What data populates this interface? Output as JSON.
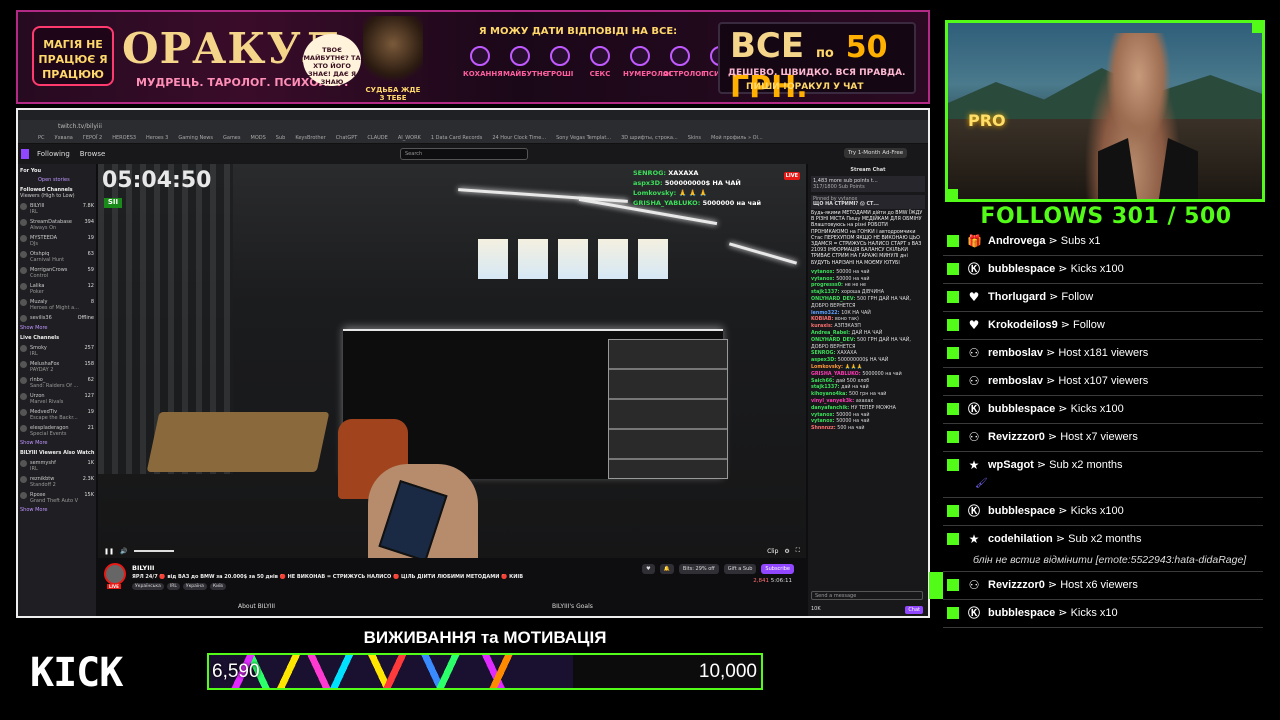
{
  "colors": {
    "kick_green": "#53fc18",
    "twitch_purple": "#9147ff",
    "banner_border": "#b32a86"
  },
  "banner": {
    "tag": "МАГІЯ НЕ ПРАЦЮЄ Я ПРАЦЮЮ",
    "brand": "ОРАКУЛ",
    "brand_sub": "МУДРЕЦЬ. ТАРОЛОГ. ПСИХОЛОГ.",
    "bubble": "ТВОЄ МАЙБУТНЄ? ТА ХТО ЙОГО ЗНАЄ! ДАЄ Я ЗНАЮ",
    "wizard_caption": "СУДЬБА ЖДЕ З ТЕБЕ",
    "headline": "Я МОЖУ ДАТИ ВІДПОВІДІ НА ВСЕ:",
    "topics": [
      "КОХАННЯ",
      "МАЙБУТНЄ",
      "ГРОШІ",
      "СЕКС",
      "НУМЕРОЛОГ",
      "АСТРОЛОГ",
      "ПСИХОЛОГ"
    ],
    "offer_big": "ВСЕ",
    "offer_mid": "по",
    "offer_price": "50 ГРН.",
    "offer_line2": "ДЕШЕВО. ШВИДКО. ВСЯ ПРАВДА.",
    "offer_line3": "ПИШИ !ОРАКУЛ У ЧАТ"
  },
  "browser": {
    "url": "twitch.tv/bilyiii",
    "bookmarks": [
      "PC",
      "Ухвала",
      "ГЕРОЇ 2",
      "HEROES3",
      "Heroes 3",
      "Gaming News",
      "Games",
      "MODS",
      "Sub",
      "KeysBrother",
      "ChatGPT",
      "CLAUDE",
      "AI_WORK",
      "1 Data Card Records",
      "24 Hour Clock Time...",
      "Sony Vegas Templat...",
      "3D шрифты, строка...",
      "Skins",
      "Мой профиль » Ol..."
    ],
    "nav": [
      "Following",
      "Browse"
    ],
    "search_placeholder": "Search",
    "try_label": "Try 1-Month Ad-Free",
    "sidebar": {
      "for_you": "For You",
      "open_stories": "Open stories",
      "followed_header": "Followed Channels",
      "followed_sub": "Viewers (High to Low)",
      "followed": [
        {
          "name": "BILYIII",
          "game": "IRL",
          "viewers": "7.8K"
        },
        {
          "name": "StreamDatabase",
          "game": "Always On",
          "viewers": "394"
        },
        {
          "name": "MYSTEEDA",
          "game": "DJs",
          "viewers": "19"
        },
        {
          "name": "Otshpiq",
          "game": "Carnival Hunt",
          "viewers": "63"
        },
        {
          "name": "MorriganCrows",
          "game": "Control",
          "viewers": "59"
        },
        {
          "name": "Lalika",
          "game": "Poker",
          "viewers": "12"
        },
        {
          "name": "Muzaly",
          "game": "Heroes of Might a...",
          "viewers": "8"
        },
        {
          "name": "sevilis36",
          "game": "",
          "viewers": "Offline"
        }
      ],
      "show_more": "Show More",
      "live_header": "Live Channels",
      "live": [
        {
          "name": "Smoky",
          "game": "IRL",
          "viewers": "257"
        },
        {
          "name": "MelushaFox",
          "game": "PAYDAY 2",
          "viewers": "158"
        },
        {
          "name": "rlnbo_",
          "game": "Sand: Raiders Of ...",
          "viewers": "62"
        },
        {
          "name": "Urzon",
          "game": "Marvel Rivals",
          "viewers": "127"
        },
        {
          "name": "MedvedTiv",
          "game": "Escape the Backr...",
          "viewers": "19"
        },
        {
          "name": "elespladeragon",
          "game": "Special Events",
          "viewers": "21"
        }
      ],
      "also_watch_header": "BILYIII Viewers Also Watch",
      "also_watch": [
        {
          "name": "semmyshf",
          "game": "IRL",
          "viewers": "1K"
        },
        {
          "name": "reznikbtw",
          "game": "Standoff 2",
          "viewers": "2.3K"
        },
        {
          "name": "Rpoxe",
          "game": "Grand Theft Auto V",
          "viewers": "15K"
        }
      ]
    },
    "video": {
      "timer": "05:04:50",
      "timer_sub": "SII",
      "live_badge": "LIVE",
      "overlay_chat": [
        {
          "user": "SENROG:",
          "msg": "ХАХАХА"
        },
        {
          "user": "aspx3D:",
          "msg": "500000000$ НА ЧАЙ"
        },
        {
          "user": "Lomkovsky:",
          "msg": "🙏 🙏 🙏"
        },
        {
          "user": "GRISHA_YABLUKO:",
          "msg": "5000000 на чай"
        }
      ],
      "clip_label": "Clip"
    },
    "info": {
      "live": "LIVE",
      "streamer": "BILYIII",
      "title": "ЯРЛ 24/7 🔴 від ВАЗ до BMW за 20.000$ за 50 днів 🔴 НЕ ВИКОНАВ = СТРИЖУСЬ НАЛИСО 🔴 ЦІЛЬ ДІЙТИ ЛЮБИМИ МЕТОДАМИ 🔴 КИЇВ",
      "tags": [
        "Українська",
        "IRL",
        "Україна",
        "Київ"
      ],
      "bits": "Bits: 29% off",
      "gift": "Gift a Sub",
      "subscribe": "Subscribe",
      "viewers": "2,841",
      "uptime": "5:06:11",
      "about": "About BILYIII",
      "goals": "BILYIII's Goals"
    },
    "chat": {
      "header": "Stream Chat",
      "points": "1,483 more sub points t...",
      "points_sub": "317/1800 Sub Points",
      "pinned_by": "Pinned by vytanox",
      "pinned_title": "ЩО НА СТРИМІ? 😱 СТ...",
      "pinned_body": "Будь-якими МЕТОДАМИ дійти до BMW ЇЖДУ В РІЗНІ МІСТА Пишу МЕДІЙКАМ ДЛЯ ОБМІНУ Влаштовуюсь на різні РОБОТИ ПРОНИКАЮМО на ГОНКИ і автодромчики Стас ПЕРЕХУПОМ ЯКЩО НЕ ВИКОНАЮ ЦЬО ЗДАМСЯ = СТРИЖУСЬ НАЛИСО СТАРТ з ВАЗ 21093 ІНФОРМАЦІЯ БАЛАНСУ СКІЛЬКИ ТРИВАЄ СТРИМ НА ГАРАЖІ МИНУЛІ дні БУДУТЬ НАРІЗАНІ НА МОЄМУ ЮТУБІ",
      "messages": [
        {
          "user": "vytanox:",
          "text": "50000 на чай",
          "color": "#3cdf5a"
        },
        {
          "user": "vytanox:",
          "text": "50000 на чай",
          "color": "#3cdf5a"
        },
        {
          "user": "progresss0:",
          "text": "не не не",
          "color": "#3cdf5a"
        },
        {
          "user": "stajk1337:",
          "text": "хороша ДІВЧИНА",
          "color": "#3cdf5a"
        },
        {
          "user": "ONLYHARD_DEV:",
          "text": "500 ГРН ДАЙ НА ЧАЙ, ДОБРО ВЕРНЕТСЯ",
          "color": "#3cdf5a"
        },
        {
          "user": "lenmo322:",
          "text": "10К НА ЧАЙ",
          "color": "#5fa0ff"
        },
        {
          "user": "KOBIAB:",
          "text": "воно так)",
          "color": "#ff7070"
        },
        {
          "user": "kuraxis:",
          "text": "АЗПЗКАЗП",
          "color": "#ff7070"
        },
        {
          "user": "Andrea_Rabel:",
          "text": "ДАЙ НА ЧАЙ",
          "color": "#3cdf5a"
        },
        {
          "user": "ONLYHARD_DEV:",
          "text": "500 ГРН ДАЙ НА ЧАЙ, ДОБРО ВЕРНЕТСЯ",
          "color": "#3cdf5a"
        },
        {
          "user": "SENROG:",
          "text": "ХАХАХА",
          "color": "#3cdf5a"
        },
        {
          "user": "aspex3D:",
          "text": "500000000$ НА ЧАЙ",
          "color": "#3cdf5a"
        },
        {
          "user": "Lomkovsky:",
          "text": "🙏🙏🙏",
          "color": "#ff9a3a"
        },
        {
          "user": "GRISHA_YABLUKO:",
          "text": "5000000 на чай",
          "color": "#ff3ab6"
        },
        {
          "user": "Saich66:",
          "text": "дай 500 хлоб",
          "color": "#3cdf5a"
        },
        {
          "user": "stajk1337:",
          "text": "дай на чай",
          "color": "#3cdf5a"
        },
        {
          "user": "kihoyano4ka:",
          "text": "500 грн на чай",
          "color": "#3cdf5a"
        },
        {
          "user": "vinyl_vanyek3k:",
          "text": "ахахах",
          "color": "#ff3ab6"
        },
        {
          "user": "danyafanchik:",
          "text": "НУ ТЕПЕР МОЖНА",
          "color": "#3cdf5a"
        },
        {
          "user": "vytanox:",
          "text": "50000 на чай",
          "color": "#3cdf5a"
        },
        {
          "user": "vytanox:",
          "text": "50000 на чай",
          "color": "#3cdf5a"
        },
        {
          "user": "Shnnnzz:",
          "text": "500 на чай",
          "color": "#ff7070"
        }
      ],
      "send_placeholder": "Send a message",
      "balance": "10K",
      "chat_button": "Chat"
    }
  },
  "follows": {
    "title": "FOLLOWS 301 / 500",
    "events": [
      {
        "icon": "gift-icon",
        "glyph": "🎁",
        "user": "Androvega",
        "action": " ⋗ Subs x1"
      },
      {
        "icon": "kick-k-icon",
        "glyph": "Ⓚ",
        "user": "bubblespace",
        "action": " ⋗ Kicks x100"
      },
      {
        "icon": "heart-icon",
        "glyph": "♥",
        "user": "Thorlugard",
        "action": " ⋗ Follow"
      },
      {
        "icon": "heart-icon",
        "glyph": "♥",
        "user": "Krokodeilos9",
        "action": " ⋗ Follow"
      },
      {
        "icon": "host-users-icon",
        "glyph": "⚇",
        "user": "remboslav",
        "action": " ⋗ Host x181 viewers"
      },
      {
        "icon": "host-users-icon",
        "glyph": "⚇",
        "user": "remboslav",
        "action": " ⋗ Host x107 viewers"
      },
      {
        "icon": "kick-k-icon",
        "glyph": "Ⓚ",
        "user": "bubblespace",
        "action": " ⋗ Kicks x100"
      },
      {
        "icon": "host-users-icon",
        "glyph": "⚇",
        "user": "Revizzzor0",
        "action": " ⋗ Host x7 viewers"
      },
      {
        "icon": "star-icon",
        "glyph": "★",
        "user": "wpSagot",
        "action": " ⋗ Sub x2 months"
      },
      {
        "icon": "kick-k-icon",
        "glyph": "Ⓚ",
        "user": "bubblespace",
        "action": " ⋗ Kicks x100"
      },
      {
        "icon": "star-icon",
        "glyph": "★",
        "user": "codehilation",
        "action": " ⋗ Sub x2 months",
        "extra": "блін не встиг відмінити [emote:5522943:hata-didaRage]"
      },
      {
        "icon": "host-users-icon",
        "glyph": "⚇",
        "user": "Revizzzor0",
        "action": " ⋗ Host x6 viewers"
      },
      {
        "icon": "kick-k-icon",
        "glyph": "Ⓚ",
        "user": "bubblespace",
        "action": " ⋗ Kicks x10"
      }
    ]
  },
  "goal": {
    "title": "ВИЖИВАННЯ та МОТИВАЦІЯ",
    "current_label": "6,590",
    "target_label": "10,000",
    "progress_fraction": 0.659
  },
  "kick_logo": "KICK"
}
